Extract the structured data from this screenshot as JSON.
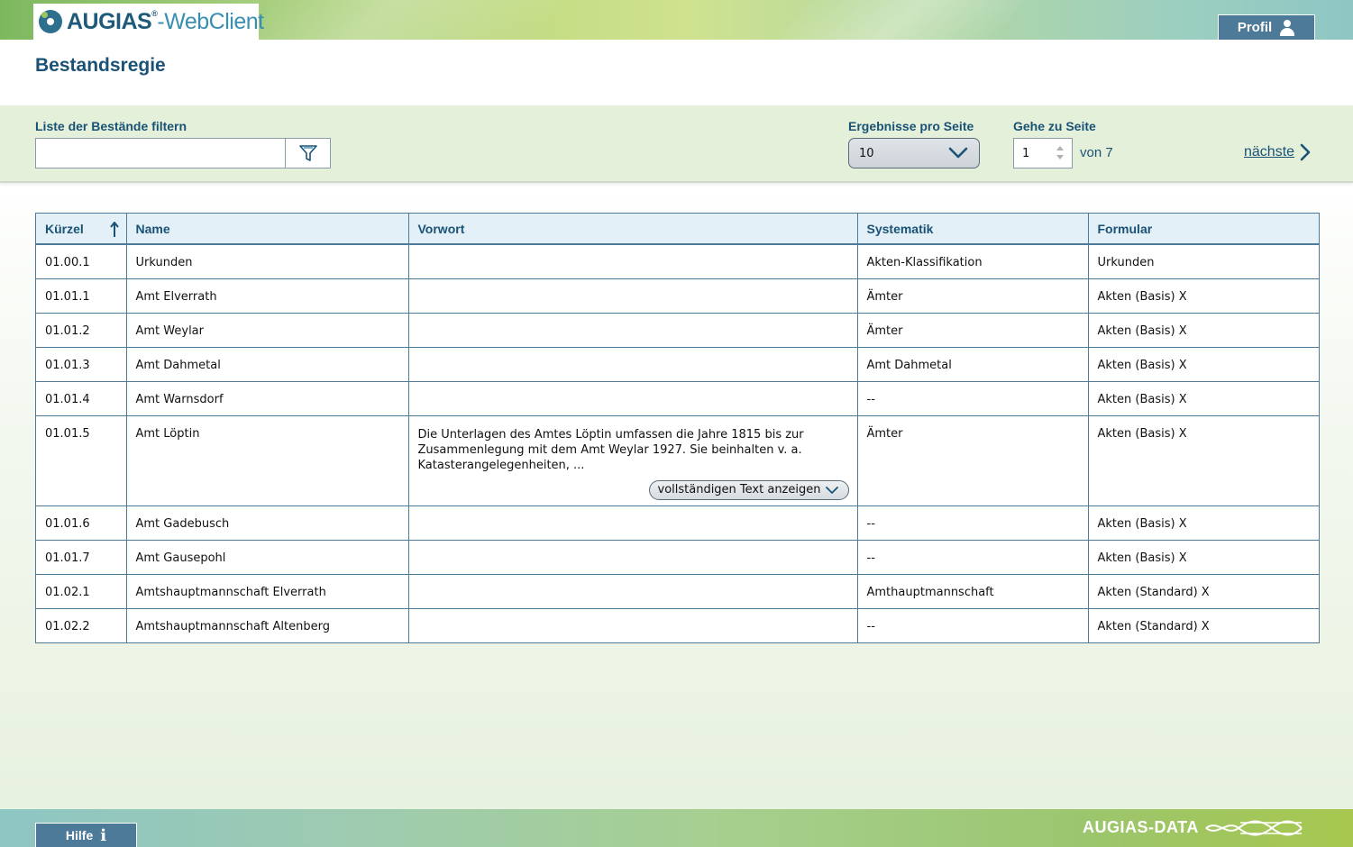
{
  "header": {
    "logo_main": "AUGIAS",
    "logo_reg": "®",
    "logo_web": "-WebClient",
    "profile_label": "Profil"
  },
  "page": {
    "title": "Bestandsregie"
  },
  "filter": {
    "label": "Liste der Bestände filtern",
    "value": "",
    "results_label": "Ergebnisse pro Seite",
    "results_value": "10",
    "goto_label": "Gehe zu Seite",
    "page_value": "1",
    "page_total": "von 7",
    "next_label": "nächste"
  },
  "table": {
    "columns": [
      "Kürzel",
      "Name",
      "Vorwort",
      "Systematik",
      "Formular"
    ],
    "rows": [
      {
        "kuerzel": "01.00.1",
        "name": "Urkunden",
        "vorwort": "",
        "systematik": "Akten-Klassifikation",
        "formular": "Urkunden"
      },
      {
        "kuerzel": "01.01.1",
        "name": "Amt Elverrath",
        "vorwort": "",
        "systematik": "Ämter",
        "formular": "Akten (Basis) X"
      },
      {
        "kuerzel": "01.01.2",
        "name": "Amt Weylar",
        "vorwort": "",
        "systematik": "Ämter",
        "formular": "Akten (Basis) X"
      },
      {
        "kuerzel": "01.01.3",
        "name": "Amt Dahmetal",
        "vorwort": "",
        "systematik": "Amt Dahmetal",
        "formular": "Akten (Basis) X"
      },
      {
        "kuerzel": "01.01.4",
        "name": "Amt Warnsdorf",
        "vorwort": "",
        "systematik": "--",
        "formular": "Akten (Basis) X"
      },
      {
        "kuerzel": "01.01.5",
        "name": "Amt Löptin",
        "vorwort": "Die Unterlagen des Amtes Löptin umfassen die Jahre 1815 bis zur Zusammenlegung mit dem Amt Weylar 1927. Sie beinhalten v. a. Katasterangelegenheiten, ...",
        "systematik": "Ämter",
        "formular": "Akten (Basis) X",
        "more_label": "vollständigen Text anzeigen"
      },
      {
        "kuerzel": "01.01.6",
        "name": "Amt Gadebusch",
        "vorwort": "",
        "systematik": "--",
        "formular": "Akten (Basis) X"
      },
      {
        "kuerzel": "01.01.7",
        "name": "Amt Gausepohl",
        "vorwort": "",
        "systematik": "--",
        "formular": "Akten (Basis) X"
      },
      {
        "kuerzel": "01.02.1",
        "name": "Amtshauptmannschaft Elverrath",
        "vorwort": "",
        "systematik": "Amthauptmannschaft",
        "formular": "Akten (Standard) X"
      },
      {
        "kuerzel": "01.02.2",
        "name": "Amtshauptmannschaft Altenberg",
        "vorwort": "",
        "systematik": "--",
        "formular": "Akten (Standard) X"
      }
    ]
  },
  "footer": {
    "help_label": "Hilfe",
    "brand": "AUGIAS-DATA"
  },
  "colors": {
    "primary": "#1a5276",
    "button": "#4d7a98",
    "filter_bg": "#e4f0da",
    "header_row": "#e4f0f7"
  }
}
